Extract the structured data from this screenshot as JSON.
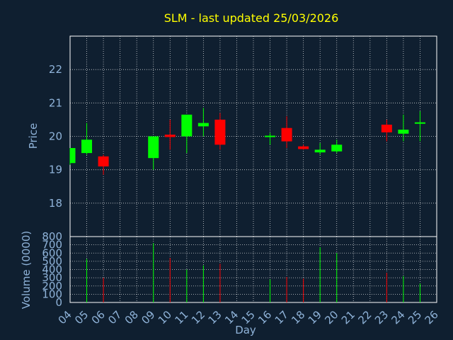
{
  "title": "SLM - last updated 25/03/2026",
  "colors": {
    "background": "#0f1f30",
    "title": "#ffff00",
    "axis_text": "#8fb3d9",
    "frame": "#ffffff",
    "grid": "#ffffff",
    "up": "#00ff00",
    "down": "#ff0000"
  },
  "chart_data": [
    {
      "type": "candlestick",
      "ylabel": "Price",
      "ylim": [
        17,
        23
      ],
      "yticks": [
        18,
        19,
        20,
        21,
        22
      ],
      "grid": true,
      "x_days": [
        "04",
        "05",
        "06",
        "07",
        "08",
        "09",
        "10",
        "11",
        "12",
        "13",
        "14",
        "15",
        "16",
        "17",
        "18",
        "19",
        "20",
        "21",
        "22",
        "23",
        "24",
        "25",
        "26"
      ],
      "candles": [
        {
          "day": "04",
          "open": 19.2,
          "high": 19.65,
          "low": 19.15,
          "close": 19.65
        },
        {
          "day": "05",
          "open": 19.5,
          "high": 20.4,
          "low": 19.45,
          "close": 19.9
        },
        {
          "day": "06",
          "open": 19.4,
          "high": 19.45,
          "low": 18.85,
          "close": 19.1
        },
        {
          "day": "09",
          "open": 19.35,
          "high": 20.0,
          "low": 19.0,
          "close": 20.0
        },
        {
          "day": "10",
          "open": 20.05,
          "high": 20.5,
          "low": 19.6,
          "close": 19.98
        },
        {
          "day": "11",
          "open": 20.0,
          "high": 20.65,
          "low": 19.5,
          "close": 20.65
        },
        {
          "day": "12",
          "open": 20.3,
          "high": 20.85,
          "low": 20.0,
          "close": 20.4
        },
        {
          "day": "13",
          "open": 20.5,
          "high": 20.7,
          "low": 19.6,
          "close": 19.75
        },
        {
          "day": "16",
          "open": 19.98,
          "high": 20.1,
          "low": 19.75,
          "close": 20.02
        },
        {
          "day": "17",
          "open": 20.25,
          "high": 20.6,
          "low": 19.65,
          "close": 19.85
        },
        {
          "day": "18",
          "open": 19.7,
          "high": 19.75,
          "low": 19.6,
          "close": 19.62
        },
        {
          "day": "19",
          "open": 19.52,
          "high": 19.8,
          "low": 19.45,
          "close": 19.6
        },
        {
          "day": "20",
          "open": 19.55,
          "high": 19.9,
          "low": 19.5,
          "close": 19.75
        },
        {
          "day": "23",
          "open": 20.35,
          "high": 20.5,
          "low": 19.85,
          "close": 20.12
        },
        {
          "day": "24",
          "open": 20.08,
          "high": 20.65,
          "low": 19.85,
          "close": 20.2
        },
        {
          "day": "25",
          "open": 20.38,
          "high": 20.75,
          "low": 19.85,
          "close": 20.42
        }
      ]
    },
    {
      "type": "bar",
      "xlabel": "Day",
      "ylabel": "Volume (0000)",
      "ylim": [
        0,
        800
      ],
      "yticks": [
        0,
        100,
        200,
        300,
        400,
        500,
        600,
        700,
        800
      ],
      "grid": true,
      "x_days": [
        "04",
        "05",
        "06",
        "07",
        "08",
        "09",
        "10",
        "11",
        "12",
        "13",
        "14",
        "15",
        "16",
        "17",
        "18",
        "19",
        "20",
        "21",
        "22",
        "23",
        "24",
        "25",
        "26"
      ],
      "bars": [
        {
          "day": "05",
          "value": 530,
          "color": "up"
        },
        {
          "day": "06",
          "value": 300,
          "color": "down"
        },
        {
          "day": "09",
          "value": 720,
          "color": "up"
        },
        {
          "day": "10",
          "value": 540,
          "color": "down"
        },
        {
          "day": "11",
          "value": 400,
          "color": "up"
        },
        {
          "day": "12",
          "value": 450,
          "color": "up"
        },
        {
          "day": "13",
          "value": 470,
          "color": "down"
        },
        {
          "day": "16",
          "value": 280,
          "color": "up"
        },
        {
          "day": "17",
          "value": 310,
          "color": "down"
        },
        {
          "day": "18",
          "value": 290,
          "color": "down"
        },
        {
          "day": "19",
          "value": 670,
          "color": "up"
        },
        {
          "day": "20",
          "value": 600,
          "color": "up"
        },
        {
          "day": "23",
          "value": 360,
          "color": "down"
        },
        {
          "day": "24",
          "value": 320,
          "color": "up"
        },
        {
          "day": "25",
          "value": 230,
          "color": "up"
        }
      ]
    }
  ]
}
